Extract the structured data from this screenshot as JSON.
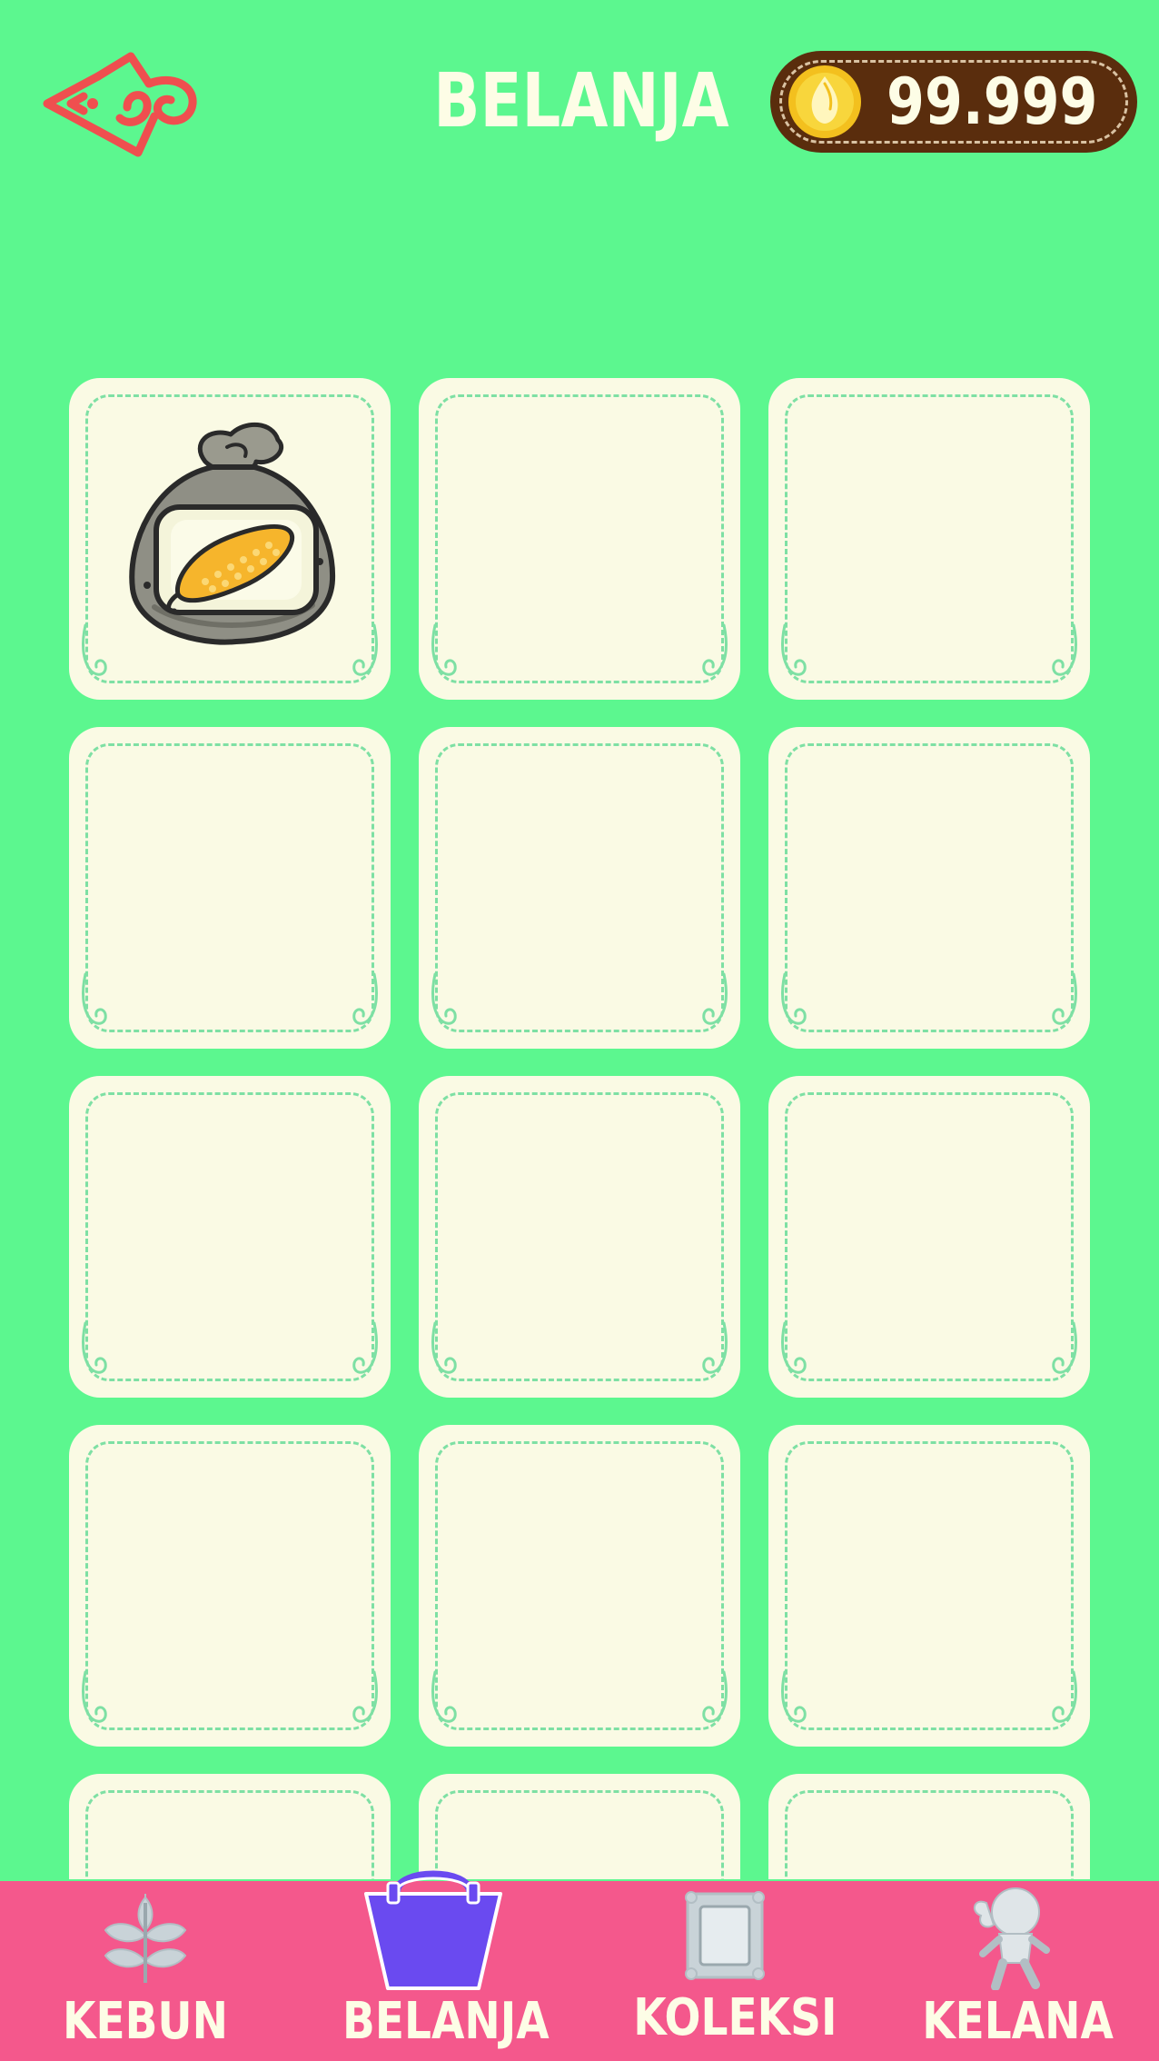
{
  "header": {
    "title": "BELANJA",
    "back_icon": "ornate-back-arrow-icon",
    "coins": {
      "value": "99.999",
      "icon": "gold-coin-icon"
    }
  },
  "shop": {
    "slots": [
      {
        "item": "corn-seed-bag",
        "icon": "corn-seed-bag-icon"
      },
      {
        "item": null
      },
      {
        "item": null
      },
      {
        "item": null
      },
      {
        "item": null
      },
      {
        "item": null
      },
      {
        "item": null
      },
      {
        "item": null
      },
      {
        "item": null
      },
      {
        "item": null
      },
      {
        "item": null
      },
      {
        "item": null
      },
      {
        "item": null
      },
      {
        "item": null
      },
      {
        "item": null
      }
    ]
  },
  "bottom_nav": {
    "active": "belanja",
    "items": [
      {
        "id": "kebun",
        "label": "KEBUN",
        "icon": "sprout-icon"
      },
      {
        "id": "belanja",
        "label": "BELANJA",
        "icon": "shopping-basket-icon"
      },
      {
        "id": "koleksi",
        "label": "KOLEKSI",
        "icon": "picture-frame-icon"
      },
      {
        "id": "kelana",
        "label": "KELANA",
        "icon": "explorer-girl-icon"
      }
    ]
  },
  "colors": {
    "background": "#5cf78f",
    "nav_bar": "#f4588c",
    "slot_fill": "#fafae4",
    "slot_dash": "#7ee0a4",
    "coin_pill": "#5a2d0d",
    "back_icon": "#ef4f4f",
    "active_nav_icon": "#6a4af0",
    "inactive_nav_icon": "#c9d3d8",
    "text_light": "#fdfde6"
  }
}
